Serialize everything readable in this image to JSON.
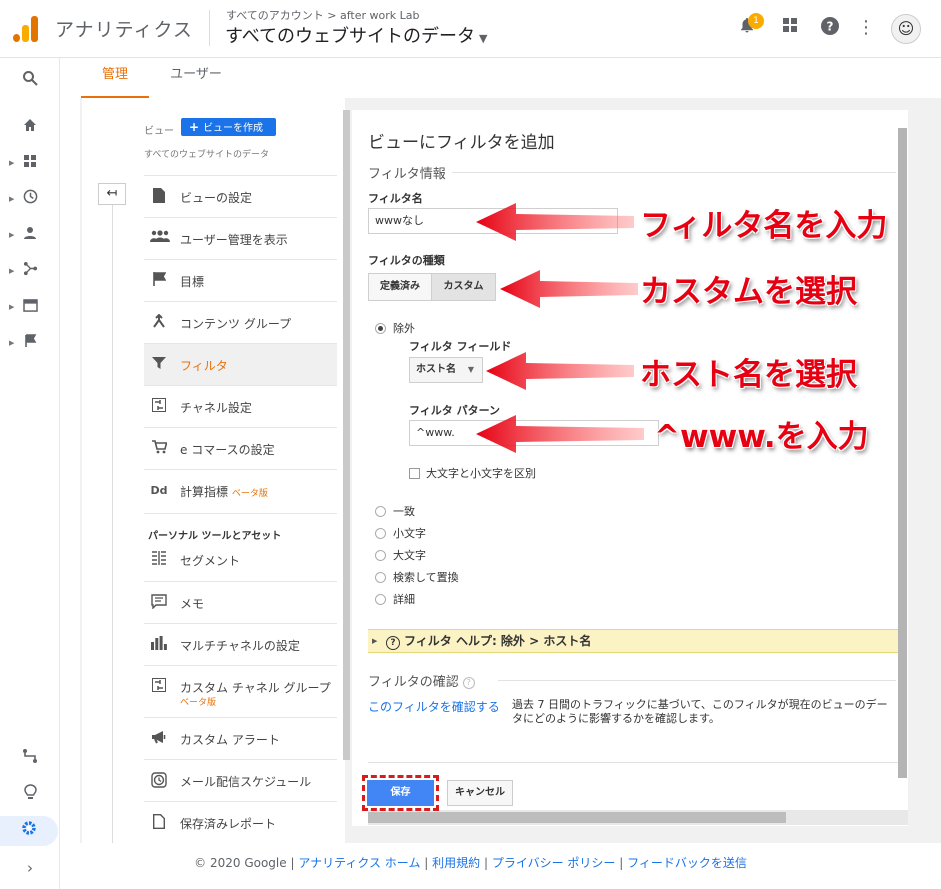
{
  "header": {
    "app_title": "アナリティクス",
    "breadcrumb_account": "すべてのアカウント",
    "breadcrumb_sep": ">",
    "breadcrumb_property": "after work Lab",
    "property_title": "すべてのウェブサイトのデータ",
    "notification_count": "1",
    "icons": [
      "bell-icon",
      "apps-icon",
      "help-icon",
      "more-icon",
      "avatar"
    ]
  },
  "tabs": {
    "admin": "管理",
    "user": "ユーザー"
  },
  "view_panel": {
    "view_label": "ビュー",
    "create_view": "ビューを作成",
    "view_name": "すべてのウェブサイトのデータ",
    "items": [
      {
        "label": "ビューの設定",
        "icon": "document-icon"
      },
      {
        "label": "ユーザー管理を表示",
        "icon": "users-icon"
      },
      {
        "label": "目標",
        "icon": "flag-icon"
      },
      {
        "label": "コンテンツ グループ",
        "icon": "content-group-icon"
      },
      {
        "label": "フィルタ",
        "icon": "filter-icon"
      },
      {
        "label": "チャネル設定",
        "icon": "channel-icon"
      },
      {
        "label": "e コマースの設定",
        "icon": "cart-icon"
      },
      {
        "label": "計算指標",
        "icon": "dd-icon",
        "badge": "ベータ版"
      }
    ],
    "personal_section": "パーソナル ツールとアセット",
    "personal_items": [
      {
        "label": "セグメント",
        "icon": "segment-icon"
      },
      {
        "label": "メモ",
        "icon": "memo-icon"
      },
      {
        "label": "マルチチャネルの設定",
        "icon": "bar-chart-icon"
      },
      {
        "label": "カスタム チャネル グループ",
        "icon": "custom-channel-icon",
        "badge": "ベータ版"
      },
      {
        "label": "カスタム アラート",
        "icon": "megaphone-icon"
      },
      {
        "label": "メール配信スケジュール",
        "icon": "clock-icon"
      },
      {
        "label": "保存済みレポート",
        "icon": "saved-report-icon"
      }
    ]
  },
  "form": {
    "title": "ビューにフィルタを追加",
    "section_info": "フィルタ情報",
    "filter_name_label": "フィルタ名",
    "filter_name_value": "wwwなし",
    "filter_type_label": "フィルタの種類",
    "type_predefined": "定義済み",
    "type_custom": "カスタム",
    "exclude_label": "除外",
    "filter_field_label": "フィルタ フィールド",
    "filter_field_value": "ホスト名",
    "filter_pattern_label": "フィルタ パターン",
    "filter_pattern_value": "^www.",
    "case_sensitive_label": "大文字と小文字を区別",
    "options": [
      "一致",
      "小文字",
      "大文字",
      "検索して置換",
      "詳細"
    ],
    "help_bar": "フィルタ ヘルプ: 除外 > ホスト名",
    "verify_heading": "フィルタの確認",
    "verify_link": "このフィルタを確認する",
    "verify_text": "過去 7 日間のトラフィックに基づいて、このフィルタが現在のビューのデータにどのように影響するかを確認します。",
    "save": "保存",
    "cancel": "キャンセル"
  },
  "annotations": {
    "a1": "フィルタ名を入力",
    "a2": "カスタムを選択",
    "a3": "ホスト名を選択",
    "a4": "^www.を入力",
    "color": "#e60012"
  },
  "footer": {
    "copyright": "© 2020 Google",
    "links": [
      "アナリティクス ホーム",
      "利用規約",
      "プライバシー ポリシー",
      "フィードバックを送信"
    ]
  }
}
